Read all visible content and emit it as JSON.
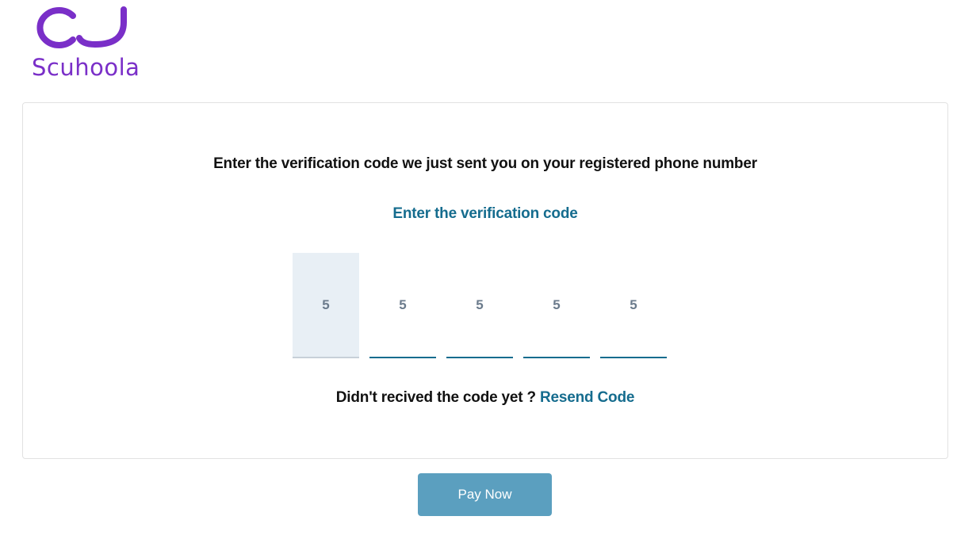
{
  "brand": {
    "name": "Scuhoola",
    "color": "#7a2fc8"
  },
  "verification": {
    "instruction": "Enter the verification code we just sent you on your registered phone number",
    "subtitle": "Enter the verification code",
    "digits": [
      "5",
      "5",
      "5",
      "5",
      "5"
    ],
    "resend_prompt": "Didn't recived the code yet ?",
    "resend_link": "Resend Code"
  },
  "actions": {
    "pay_label": "Pay Now"
  },
  "colors": {
    "accent": "#156c8e",
    "button": "#5b9fbf",
    "focused_input": "#e8eff5"
  }
}
